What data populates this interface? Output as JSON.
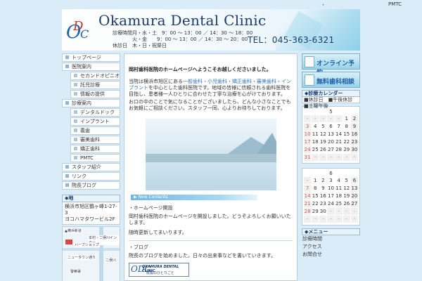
{
  "topbar": {
    "dot": "・",
    "pmtc": "PMTC"
  },
  "header": {
    "logo_o": "O",
    "logo_d": "D",
    "logo_c": "C",
    "clinic_name": "Okamura Dental Clinic",
    "hours": [
      {
        "k": "診療時間",
        "v": "月・水・土　9：00 〜 13：00 ／ 14：30 〜 18：00"
      },
      {
        "k": "",
        "v": "火・金　　9：00 〜 13：00 ／ 14：30 〜 20：00"
      },
      {
        "k": "休診日",
        "v": "木・日・祝祭日"
      }
    ],
    "tel": "TEL：045-363-6321"
  },
  "leftnav": [
    {
      "label": "トップページ",
      "sub": false
    },
    {
      "label": "医院案内",
      "sub": false
    },
    {
      "label": "セカンドオピニオン",
      "sub": true
    },
    {
      "label": "託児診療",
      "sub": true
    },
    {
      "label": "情報の提供",
      "sub": true
    },
    {
      "label": "診療案内",
      "sub": false
    },
    {
      "label": "デンタルドック",
      "sub": true
    },
    {
      "label": "インプラント",
      "sub": true
    },
    {
      "label": "義歯",
      "sub": true
    },
    {
      "label": "審美歯科",
      "sub": true
    },
    {
      "label": "矯正歯科",
      "sub": true
    },
    {
      "label": "PMTC",
      "sub": true
    },
    {
      "label": "スタッフ紹介",
      "sub": false
    },
    {
      "label": "リンク",
      "sub": false
    },
    {
      "label": "院長ブログ",
      "sub": false
    }
  ],
  "access": {
    "head": "◆地",
    "line1": "横浜市旭区鶴ヶ峰1-27-3",
    "line2": "ヨコハマタワービル2F",
    "map_labels": [
      "▲横浜新道",
      "本村・二俣川インター",
      "ハーブショップ",
      "ニュータウン通り",
      "二俣川",
      "警察署"
    ]
  },
  "main": {
    "title": "岡村歯科医院のホームページへようこそお越しくださいました。",
    "para1_a": "当院は横浜市旭区にある",
    "para1_hl": "一般歯科・小児歯科・矯正歯科・審美歯科・インプラント",
    "para1_b": "を中心とした歯科医院です。地域の皆様に信頼される歯科医院を目指し、患者様一人ひとりに合わせた丁寧な治療を心がけております。",
    "para2": "お口の中のことで気になることがございましたら、どんな小さなことでもお気軽にご相談ください。スタッフ一同、心よりお待ちしております。",
    "news_label": "New Contents",
    "news1_h": "・ホームページ開設",
    "news1_b": "岡村歯科医院のホームページを開設しました。どうぞよろしくお願いいたします。",
    "news1_b2": "随時更新してまいります。",
    "news2_h": "・ブログ",
    "news2_b": "院長のブログを始めました。日々の出来事などを書いていきます。",
    "blog_banner_logo": "ODC",
    "blog_banner_t1": "OKAMURA DENTAL CLINIC",
    "blog_banner_t2": "院長のひとりごと"
  },
  "right": {
    "btn1": "オンライン予約",
    "btn2": "無料歯科相談",
    "cal_head": "◆診療カレンダー",
    "cal_note": "■休診日　■午後休診　■土曜午後",
    "cal1_month": "5",
    "cal1": [
      [
        "-",
        "-",
        "-",
        "-",
        "-",
        "1",
        "2"
      ],
      [
        "3",
        "4",
        "5",
        "6",
        "7",
        "8",
        "9"
      ],
      [
        "10",
        "11",
        "12",
        "13",
        "14",
        "15",
        "16"
      ],
      [
        "17",
        "18",
        "19",
        "20",
        "21",
        "22",
        "23"
      ],
      [
        "24",
        "25",
        "26",
        "27",
        "28",
        "29",
        "30"
      ],
      [
        "31",
        "-",
        "-",
        "-",
        "-",
        "-",
        "-"
      ]
    ],
    "cal2_month": "6",
    "cal2": [
      [
        "-",
        "1",
        "2",
        "3",
        "4",
        "5",
        "6"
      ],
      [
        "7",
        "8",
        "9",
        "10",
        "11",
        "12",
        "13"
      ],
      [
        "14",
        "15",
        "16",
        "17",
        "18",
        "19",
        "20"
      ],
      [
        "21",
        "22",
        "23",
        "24",
        "25",
        "26",
        "27"
      ],
      [
        "28",
        "29",
        "30",
        "-",
        "-",
        "-",
        "-"
      ],
      [
        "-",
        "-",
        "-",
        "-",
        "-",
        "-",
        "-"
      ]
    ],
    "list_head": "◆メニュー",
    "list": [
      "診療時間",
      "アクセス",
      "お問合せ"
    ]
  }
}
